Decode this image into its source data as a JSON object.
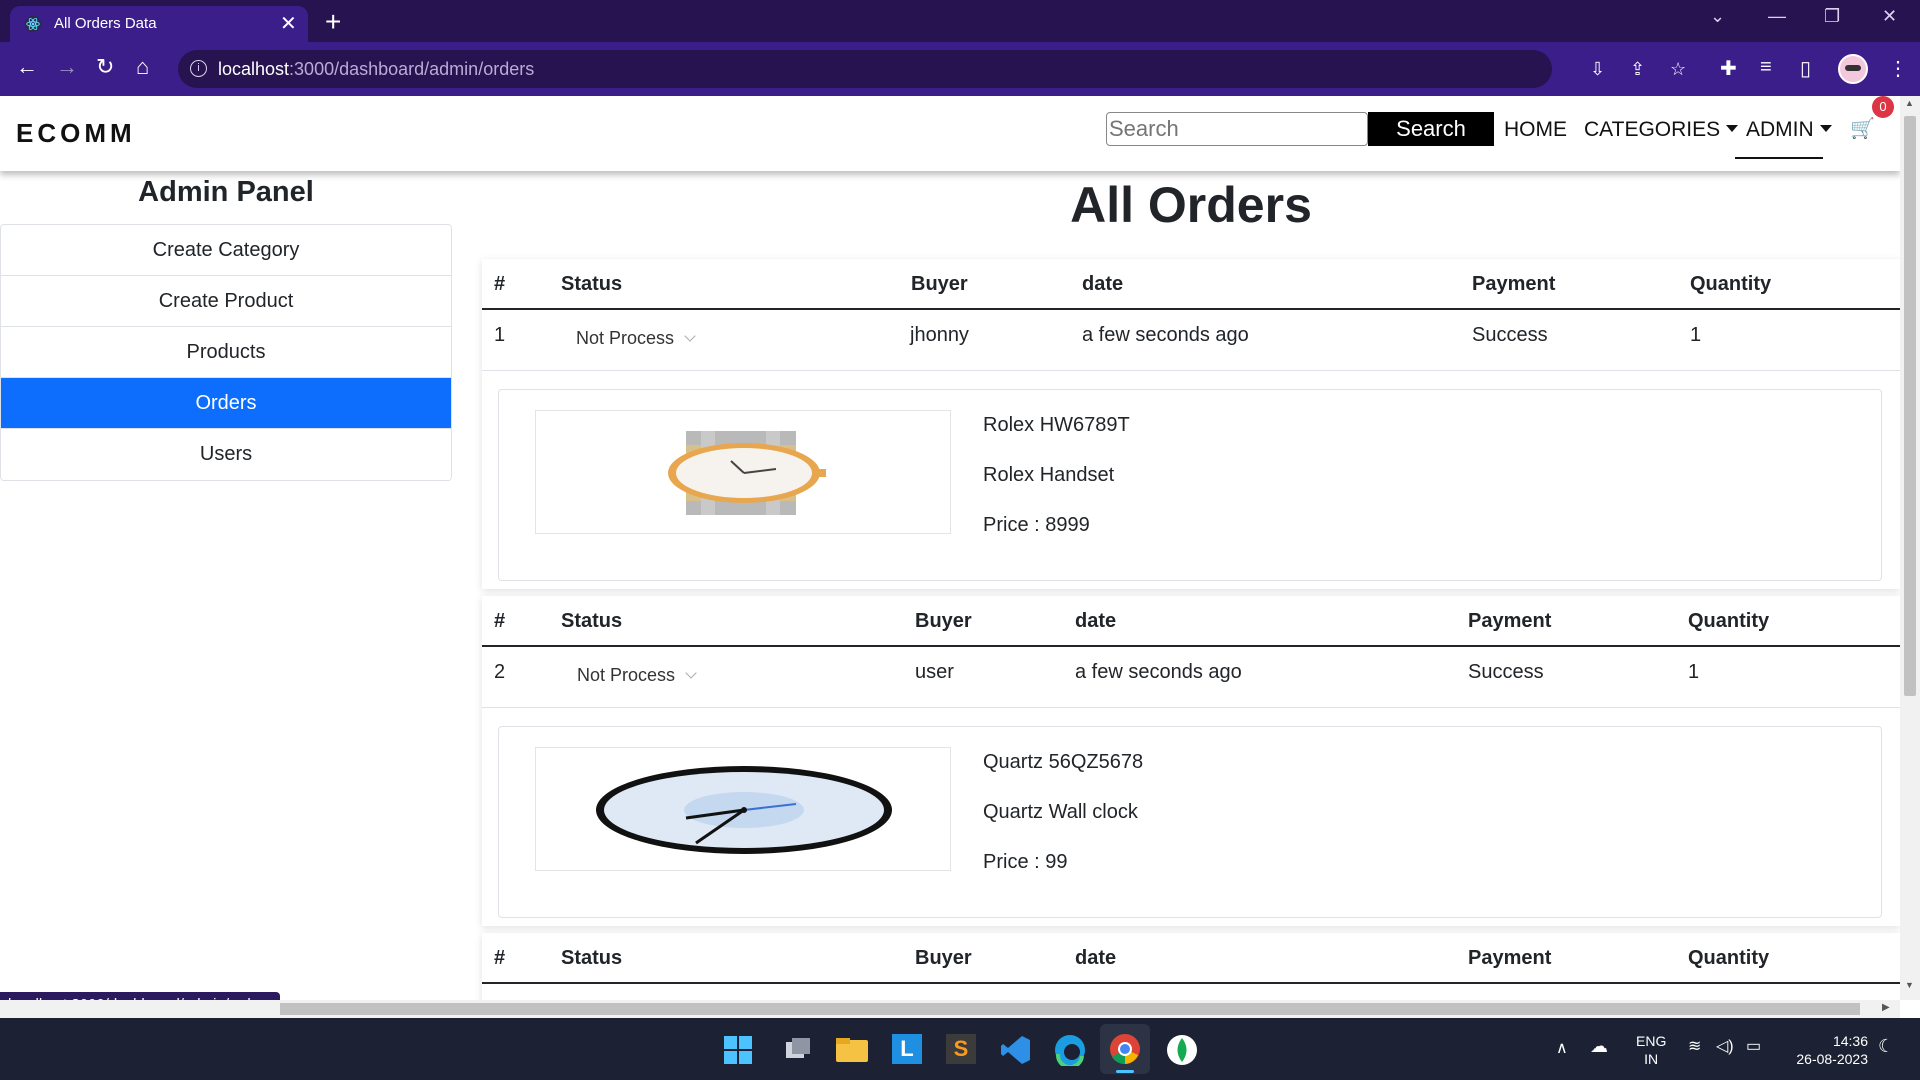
{
  "browser": {
    "tab_title": "All Orders Data",
    "url_host": "localhost",
    "url_rest": ":3000/dashboard/admin/orders",
    "status_url": "localhost:3000/dashboard/admin/orders"
  },
  "navbar": {
    "brand": "ECOMM",
    "search_placeholder": "Search",
    "search_button": "Search",
    "home": "HOME",
    "categories": "CATEGORIES",
    "admin": "ADMIN",
    "cart_count": "0"
  },
  "sidebar": {
    "title": "Admin Panel",
    "items": [
      {
        "label": "Create Category"
      },
      {
        "label": "Create Product"
      },
      {
        "label": "Products"
      },
      {
        "label": "Orders"
      },
      {
        "label": "Users"
      }
    ]
  },
  "main": {
    "title": "All Orders",
    "headers": {
      "num": "#",
      "status": "Status",
      "buyer": "Buyer",
      "date": "date",
      "payment": "Payment",
      "quantity": "Quantity"
    },
    "orders": [
      {
        "num": "1",
        "status": "Not Process",
        "buyer": "jhonny",
        "date": "a few seconds ago",
        "payment": "Success",
        "quantity": "1",
        "product": {
          "name": "Rolex HW6789T",
          "description": "Rolex Handset",
          "price": "Price : 8999"
        }
      },
      {
        "num": "2",
        "status": "Not Process",
        "buyer": "user",
        "date": "a few seconds ago",
        "payment": "Success",
        "quantity": "1",
        "product": {
          "name": "Quartz 56QZ5678",
          "description": "Quartz Wall clock",
          "price": "Price : 99"
        }
      }
    ]
  },
  "taskbar": {
    "lang": "ENG",
    "region": "IN",
    "time": "14:36",
    "date": "26-08-2023"
  }
}
